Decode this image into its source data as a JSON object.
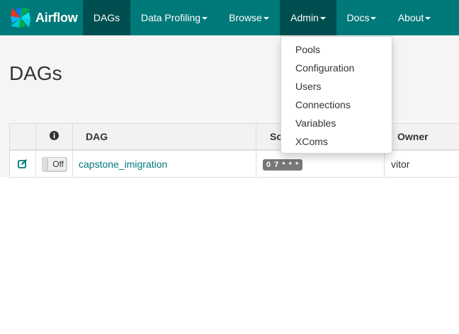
{
  "app": {
    "brand": "Airflow"
  },
  "nav": {
    "dags": "DAGs",
    "data_profiling": "Data Profiling",
    "browse": "Browse",
    "admin": "Admin",
    "docs": "Docs",
    "about": "About"
  },
  "admin_menu": {
    "items": [
      "Pools",
      "Configuration",
      "Users",
      "Connections",
      "Variables",
      "XComs"
    ]
  },
  "page": {
    "title": "DAGs"
  },
  "table": {
    "headers": {
      "dag": "DAG",
      "schedule": "Sc",
      "owner": "Owner"
    },
    "rows": [
      {
        "toggle": "Off",
        "dag": "capstone_imigration",
        "schedule": "0 7 * * *",
        "owner": "vitor"
      }
    ]
  },
  "colors": {
    "navbar": "#00797a",
    "active_nav": "#004f50",
    "link": "#00797a",
    "badge": "#777777"
  },
  "icons": {
    "brand": "pinwheel-logo-icon",
    "info": "info-circle-icon",
    "edit": "edit-icon"
  }
}
